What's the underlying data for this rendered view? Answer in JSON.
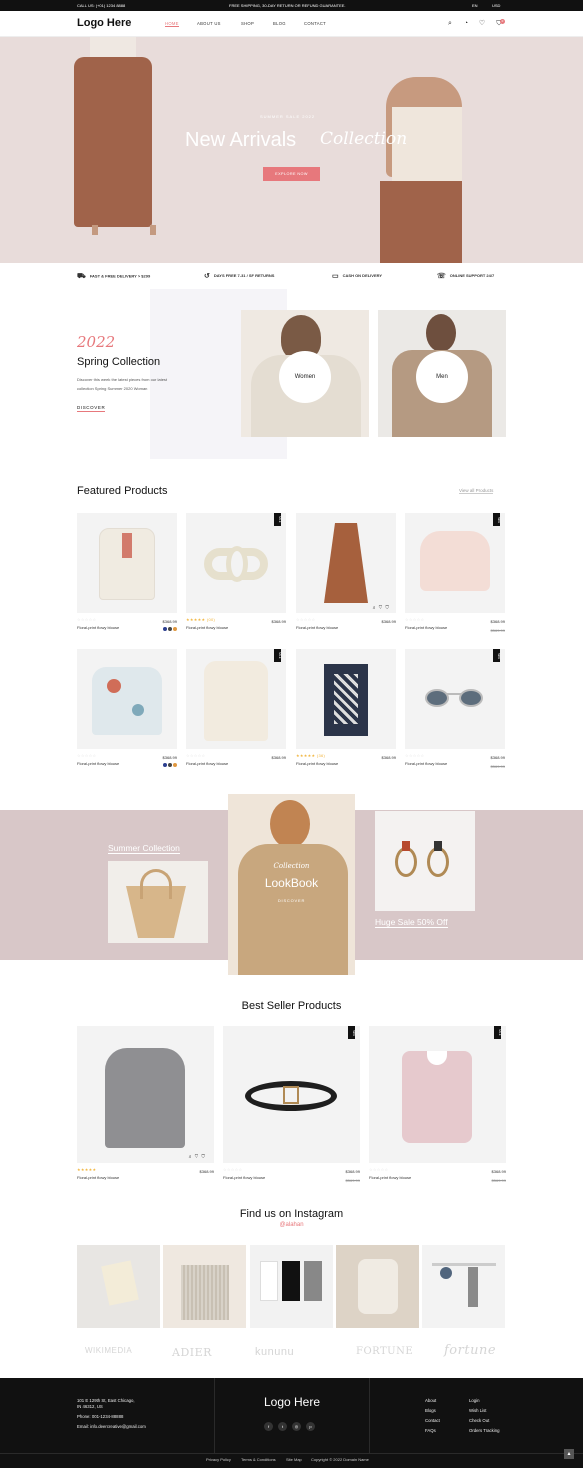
{
  "topbar": {
    "phone": "CALL US: (+01) 1234 8888",
    "promo": "FREE SHIPPING, 30-DAY RETURN OR REFUND GUARANTEE.",
    "lang": "EN",
    "currency": "USD"
  },
  "header": {
    "logo": "Logo Here",
    "nav": [
      "HOME",
      "ABOUT US",
      "SHOP",
      "BLOG",
      "CONTACT"
    ],
    "cart_count": "0"
  },
  "hero": {
    "kicker": "SUMMER SALE 2022",
    "title": "New Arrivals",
    "script": "Collection",
    "button": "EXPLORE NOW"
  },
  "services": [
    "FAST & FREE DELIVERY > $299",
    "DAYS FREE 7-31 / SF RETURNS",
    "CASH ON DELIVERY",
    "ONLINE SUPPORT 24/7"
  ],
  "spring": {
    "year": "2022",
    "title": "Spring Collection",
    "desc1": "Discover this week the latest pieces from our latest",
    "desc2": "collection Spring Summer 2020 Woman",
    "link": "DISCOVER",
    "women": "Women",
    "men": "Men"
  },
  "featured": {
    "title": "Featured Products",
    "view_all": "View all Products",
    "products": [
      {
        "name": "Floral-print flowy blouse",
        "price": "$368.99",
        "old": "",
        "stars": "☆☆☆☆☆",
        "tag": ""
      },
      {
        "name": "Floral-print flowy blouse",
        "price": "$368.99",
        "old": "",
        "stars": "★★★★★ (00)",
        "tag": "SALE"
      },
      {
        "name": "Floral-print flowy blouse",
        "price": "$368.99",
        "old": "",
        "stars": "☆☆☆☆☆",
        "tag": ""
      },
      {
        "name": "Floral-print flowy blouse",
        "price": "$368.99",
        "old": "$569.99",
        "stars": "☆☆☆☆☆",
        "tag": "NEW"
      },
      {
        "name": "Floral-print flowy blouse",
        "price": "$368.99",
        "old": "",
        "stars": "☆☆☆☆☆",
        "tag": ""
      },
      {
        "name": "Floral-print flowy blouse",
        "price": "$368.99",
        "old": "",
        "stars": "☆☆☆☆☆",
        "tag": "SALE"
      },
      {
        "name": "Floral-print flowy blouse",
        "price": "$368.99",
        "old": "",
        "stars": "★★★★★ (36)",
        "tag": ""
      },
      {
        "name": "Floral-print flowy blouse",
        "price": "$368.99",
        "old": "$569.99",
        "stars": "☆☆☆☆☆",
        "tag": "NEW"
      }
    ]
  },
  "lookbook": {
    "summer": "Summer Collection",
    "script": "Collection",
    "title": "LookBook",
    "discover": "DISCOVER",
    "huge": "Huge Sale 50% Off"
  },
  "bestseller": {
    "title": "Best Seller Products",
    "products": [
      {
        "name": "Floral-print flowy blouse",
        "price": "$368.99",
        "old": "",
        "stars": "★★★★★",
        "tag": ""
      },
      {
        "name": "Floral-print flowy blouse",
        "price": "$368.99",
        "old": "$569.99",
        "stars": "☆☆☆☆☆",
        "tag": "NEW"
      },
      {
        "name": "Floral-print flowy blouse",
        "price": "$368.99",
        "old": "$569.99",
        "stars": "☆☆☆☆☆",
        "tag": "SALE"
      }
    ]
  },
  "instagram": {
    "title": "Find us on Instagram",
    "handle": "@alahan"
  },
  "brands": [
    "WIKIMEDIA",
    "ADIER",
    "kununu",
    "FORTUNE",
    "fortune"
  ],
  "footer": {
    "address1": "101 E 129th St, East Chicago,",
    "address2": "IN 46312, US",
    "phone": "Phone: 001-1234-88888",
    "email": "Email: info.deercreative@gmail.com",
    "logo": "Logo Here",
    "links1": [
      "About",
      "Blogs",
      "Contact",
      "FAQs"
    ],
    "links2": [
      "Login",
      "Wish List",
      "Check Out",
      "Orders Tracking"
    ],
    "bottom": [
      "Privacy Policy",
      "Terms & Conditions",
      "Site Map",
      "Copyright © 2022 Domain Name"
    ]
  },
  "colors": {
    "accent": "#e7787c",
    "dark": "#111111",
    "mauve": "#d8c7c8"
  }
}
